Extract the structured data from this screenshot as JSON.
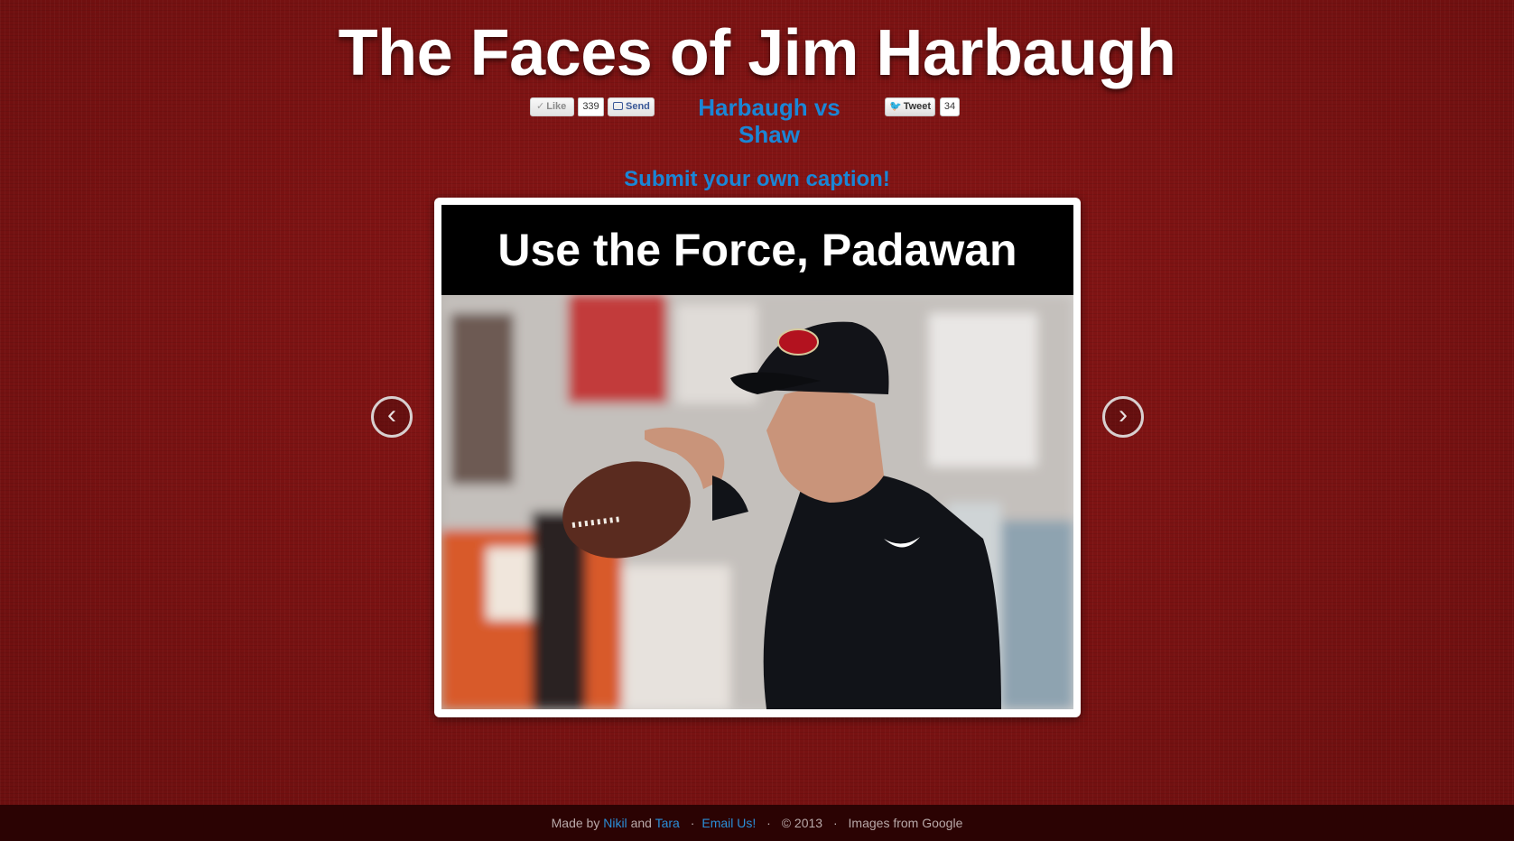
{
  "header": {
    "title": "The Faces of Jim Harbaugh"
  },
  "social": {
    "like_label": "Like",
    "like_count": "339",
    "send_label": "Send",
    "vs_link": "Harbaugh vs Shaw",
    "tweet_label": "Tweet",
    "tweet_count": "34"
  },
  "submit_caption": "Submit your own caption!",
  "slide": {
    "caption": "Use the Force, Padawan",
    "prev_symbol": "‹",
    "next_symbol": "›"
  },
  "footer": {
    "made_by": "Made by",
    "author1": "Nikil",
    "and": "and",
    "author2": "Tara",
    "sep1": "·",
    "email": "Email Us!",
    "sep2": "·",
    "copyright": "© 2013",
    "sep3": "·",
    "images": "Images from Google"
  },
  "colors": {
    "background": "#7c1212",
    "link": "#1a86d6",
    "footer_bg": "#2b0303"
  }
}
